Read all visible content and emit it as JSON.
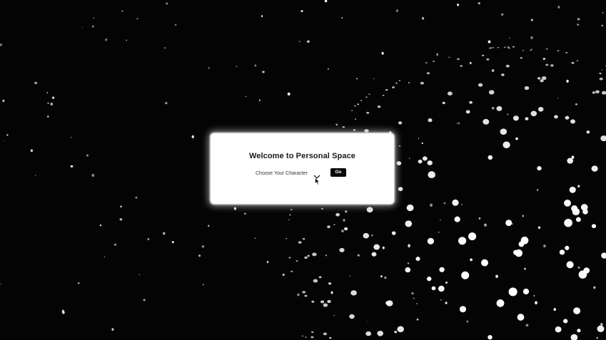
{
  "modal": {
    "title": "Welcome to Personal Space",
    "select": {
      "selected_label": "Choose Your Character",
      "icon": "chevron-down-icon"
    },
    "go_button_label": "Go"
  },
  "background": {
    "description_icon": "starfield-globe",
    "color": "#040404",
    "star_color": "#ffffff"
  },
  "cursor": {
    "icon": "mouse-pointer-icon"
  }
}
